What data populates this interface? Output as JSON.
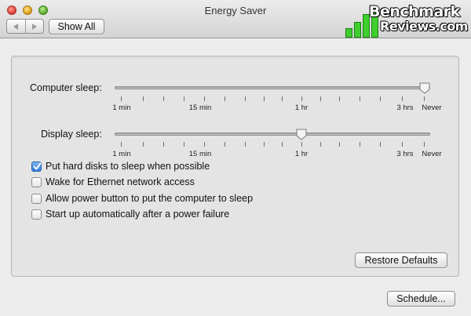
{
  "window": {
    "title": "Energy Saver",
    "show_all_label": "Show All"
  },
  "logo": {
    "line1": "Benchmark",
    "line2": "Reviews.com"
  },
  "sliders": {
    "computer": {
      "label": "Computer sleep:",
      "value": "Never",
      "ticks": [
        "1 min",
        "15 min",
        "1 hr",
        "3 hrs",
        "Never"
      ]
    },
    "display": {
      "label": "Display sleep:",
      "value": "1 hr",
      "ticks": [
        "1 min",
        "15 min",
        "1 hr",
        "3 hrs",
        "Never"
      ]
    }
  },
  "options": [
    {
      "label": "Put hard disks to sleep when possible",
      "checked": true
    },
    {
      "label": "Wake for Ethernet network access",
      "checked": false
    },
    {
      "label": "Allow power button to put the computer to sleep",
      "checked": false
    },
    {
      "label": "Start up automatically after a power failure",
      "checked": false
    }
  ],
  "buttons": {
    "restore_defaults": "Restore Defaults",
    "schedule": "Schedule..."
  },
  "colors": {
    "checkbox_accent": "#2f7bd9",
    "logo_green": "#3fce2e"
  },
  "icons": {
    "back": "left-arrow-icon",
    "forward": "right-arrow-icon",
    "checkmark": "checkmark-icon"
  }
}
